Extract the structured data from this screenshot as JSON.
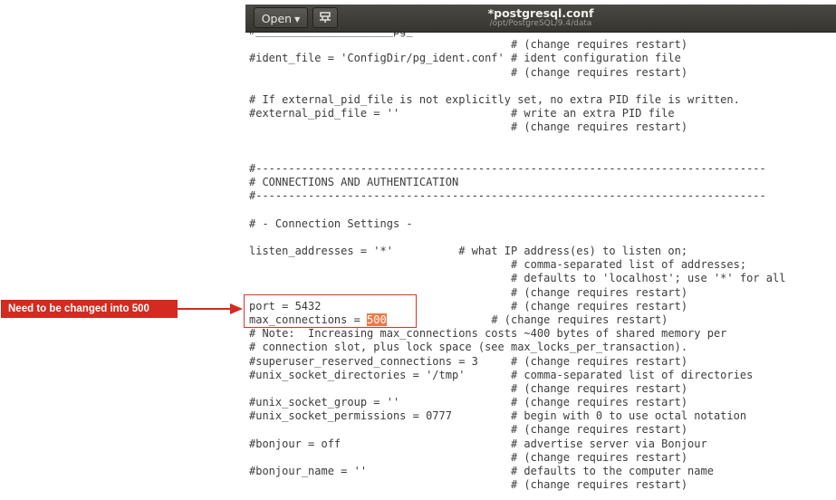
{
  "window": {
    "open_label": "Open",
    "title": "*postgresql.conf",
    "path": "/opt/PostgreSQL/9.4/data",
    "colors": {
      "titlebar": "#3c3b37",
      "highlight": "#f07746",
      "annotation": "#d42a1f"
    }
  },
  "editor": {
    "lines": [
      "#_____________________pg_",
      "                                        # (change requires restart)",
      "#ident_file = 'ConfigDir/pg_ident.conf' # ident configuration file",
      "                                        # (change requires restart)",
      "",
      "# If external_pid_file is not explicitly set, no extra PID file is written.",
      "#external_pid_file = ''                 # write an extra PID file",
      "                                        # (change requires restart)",
      "",
      "",
      "#------------------------------------------------------------------------------",
      "# CONNECTIONS AND AUTHENTICATION",
      "#------------------------------------------------------------------------------",
      "",
      "# - Connection Settings -",
      "",
      "listen_addresses = '*'          # what IP address(es) to listen on;",
      "                                        # comma-separated list of addresses;",
      "                                        # defaults to 'localhost'; use '*' for all",
      "                                        # (change requires restart)",
      "port = 5432                             # (change requires restart)",
      "",
      "# Note:  Increasing max_connections costs ~400 bytes of shared memory per",
      "# connection slot, plus lock space (see max_locks_per_transaction).",
      "#superuser_reserved_connections = 3     # (change requires restart)",
      "#unix_socket_directories = '/tmp'       # comma-separated list of directories",
      "                                        # (change requires restart)",
      "#unix_socket_group = ''                 # (change requires restart)",
      "#unix_socket_permissions = 0777         # begin with 0 to use octal notation",
      "                                        # (change requires restart)",
      "#bonjour = off                          # advertise server via Bonjour",
      "                                        # (change requires restart)",
      "#bonjour_name = ''                      # defaults to the computer name",
      "                                        # (change requires restart)"
    ],
    "max_conn_prefix": "max_connections = ",
    "max_conn_value": "500",
    "max_conn_suffix": "                # (change requires restart)"
  },
  "annotation": {
    "label": "Need to be changed into 500"
  }
}
